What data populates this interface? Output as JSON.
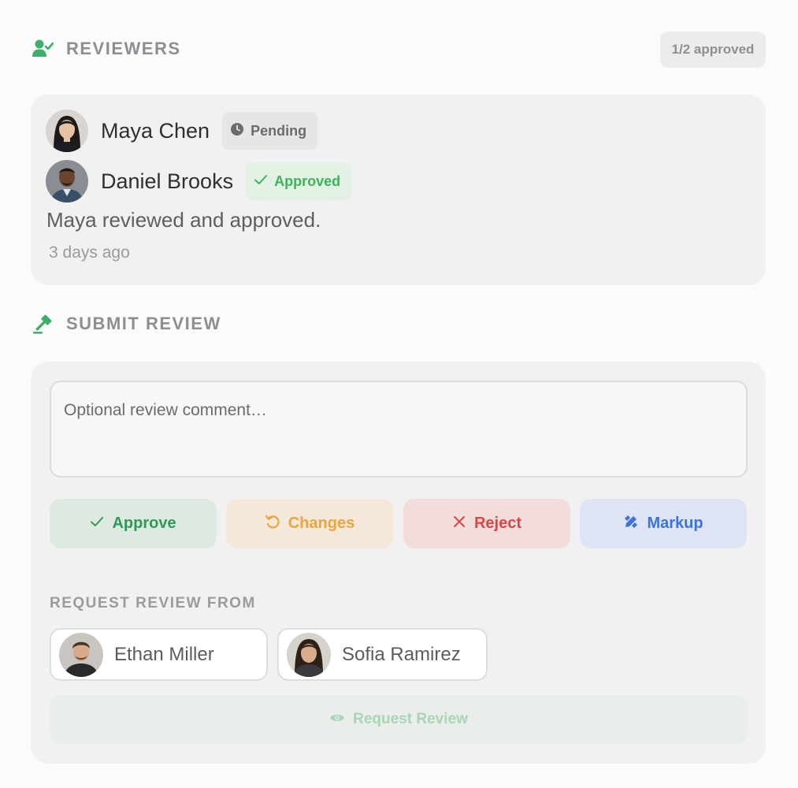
{
  "reviewers_section": {
    "title": "REVIEWERS",
    "icon": "user-check-icon",
    "approved_count": "1/2 approved",
    "reviewers": [
      {
        "name": "Maya Chen",
        "status": "Pending",
        "status_icon": "clock-icon",
        "status_color": "#6c6c70"
      },
      {
        "name": "Daniel Brooks",
        "status": "Approved",
        "status_icon": "check-icon",
        "status_color": "#3fb35a"
      }
    ],
    "summary": "Maya reviewed and approved.",
    "time": "3 days ago"
  },
  "submit_section": {
    "title": "SUBMIT REVIEW",
    "icon": "gavel-icon",
    "comment_placeholder": "Optional review comment…",
    "actions": {
      "approve": "Approve",
      "changes": "Changes",
      "reject": "Reject",
      "markup": "Markup"
    },
    "request_title": "REQUEST REVIEW FROM",
    "candidates": [
      {
        "name": "Ethan Miller"
      },
      {
        "name": "Sofia Ramirez"
      }
    ],
    "request_button": "Request Review"
  },
  "colors": {
    "accent_green": "#3fae6b",
    "approve": "#2f9a58",
    "changes": "#eaa53b",
    "reject": "#dd4545",
    "markup": "#3d73d8"
  }
}
